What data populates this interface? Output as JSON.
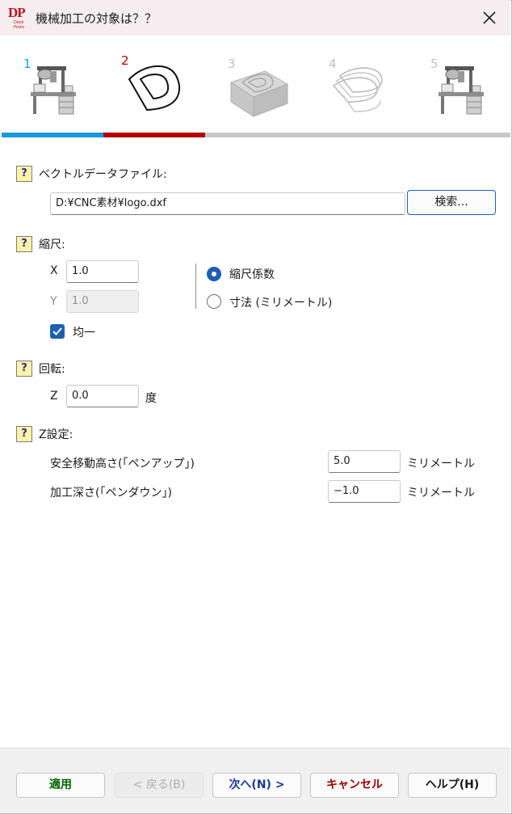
{
  "window": {
    "title": "機械加工の対象は？？",
    "logo_text": "DP",
    "logo_sub": "Desk Proto",
    "close_icon": "close-icon"
  },
  "steps": [
    {
      "number": "1",
      "icon": "cnc-machine-icon",
      "state": "done",
      "color": "#18a0d8"
    },
    {
      "number": "2",
      "icon": "vector-d-shape-icon",
      "state": "current",
      "color": "#c00000"
    },
    {
      "number": "3",
      "icon": "block-3d-icon",
      "state": "pending",
      "color": "#c8c8c8"
    },
    {
      "number": "4",
      "icon": "toolpath-layers-icon",
      "state": "pending",
      "color": "#c8c8c8"
    },
    {
      "number": "5",
      "icon": "cnc-machine-icon",
      "state": "pending",
      "color": "#c8c8c8"
    }
  ],
  "progress_colors": {
    "done": "#1a9ad8",
    "current": "#b30000",
    "pending": "#c8c8c8"
  },
  "vector": {
    "help": "?",
    "label": "ベクトルデータファイル:",
    "file_value": "D:¥CNC素材¥logo.dxf",
    "search_button": "検索..."
  },
  "scale": {
    "help": "?",
    "label": "縮尺:",
    "x_label": "X",
    "x_value": "1.0",
    "y_label": "Y",
    "y_value": "1.0",
    "uniform_label": "均一",
    "uniform_checked": true,
    "options": [
      "縮尺係数",
      "寸法 (ミリメートル)"
    ],
    "selected_option": "縮尺係数"
  },
  "rotation": {
    "help": "?",
    "label": "回転:",
    "z_label": "Z",
    "z_value": "0.0",
    "unit": "度"
  },
  "z_settings": {
    "help": "?",
    "label": "Z設定:",
    "safe_height_label": "安全移動高さ(「ペンアップ」)",
    "safe_height_value": "5.0",
    "safe_height_unit": "ミリメートル",
    "depth_label": "加工深さ(「ペンダウン」)",
    "depth_value": "−1.0",
    "depth_unit": "ミリメートル"
  },
  "footer": {
    "apply": "適用",
    "back": "< 戻る(B)",
    "next": "次へ(N) >",
    "cancel": "キャンセル",
    "help": "ヘルプ(H)",
    "apply_color": "#006400",
    "cancel_color": "#a00000",
    "next_color": "#1a3a9a"
  }
}
